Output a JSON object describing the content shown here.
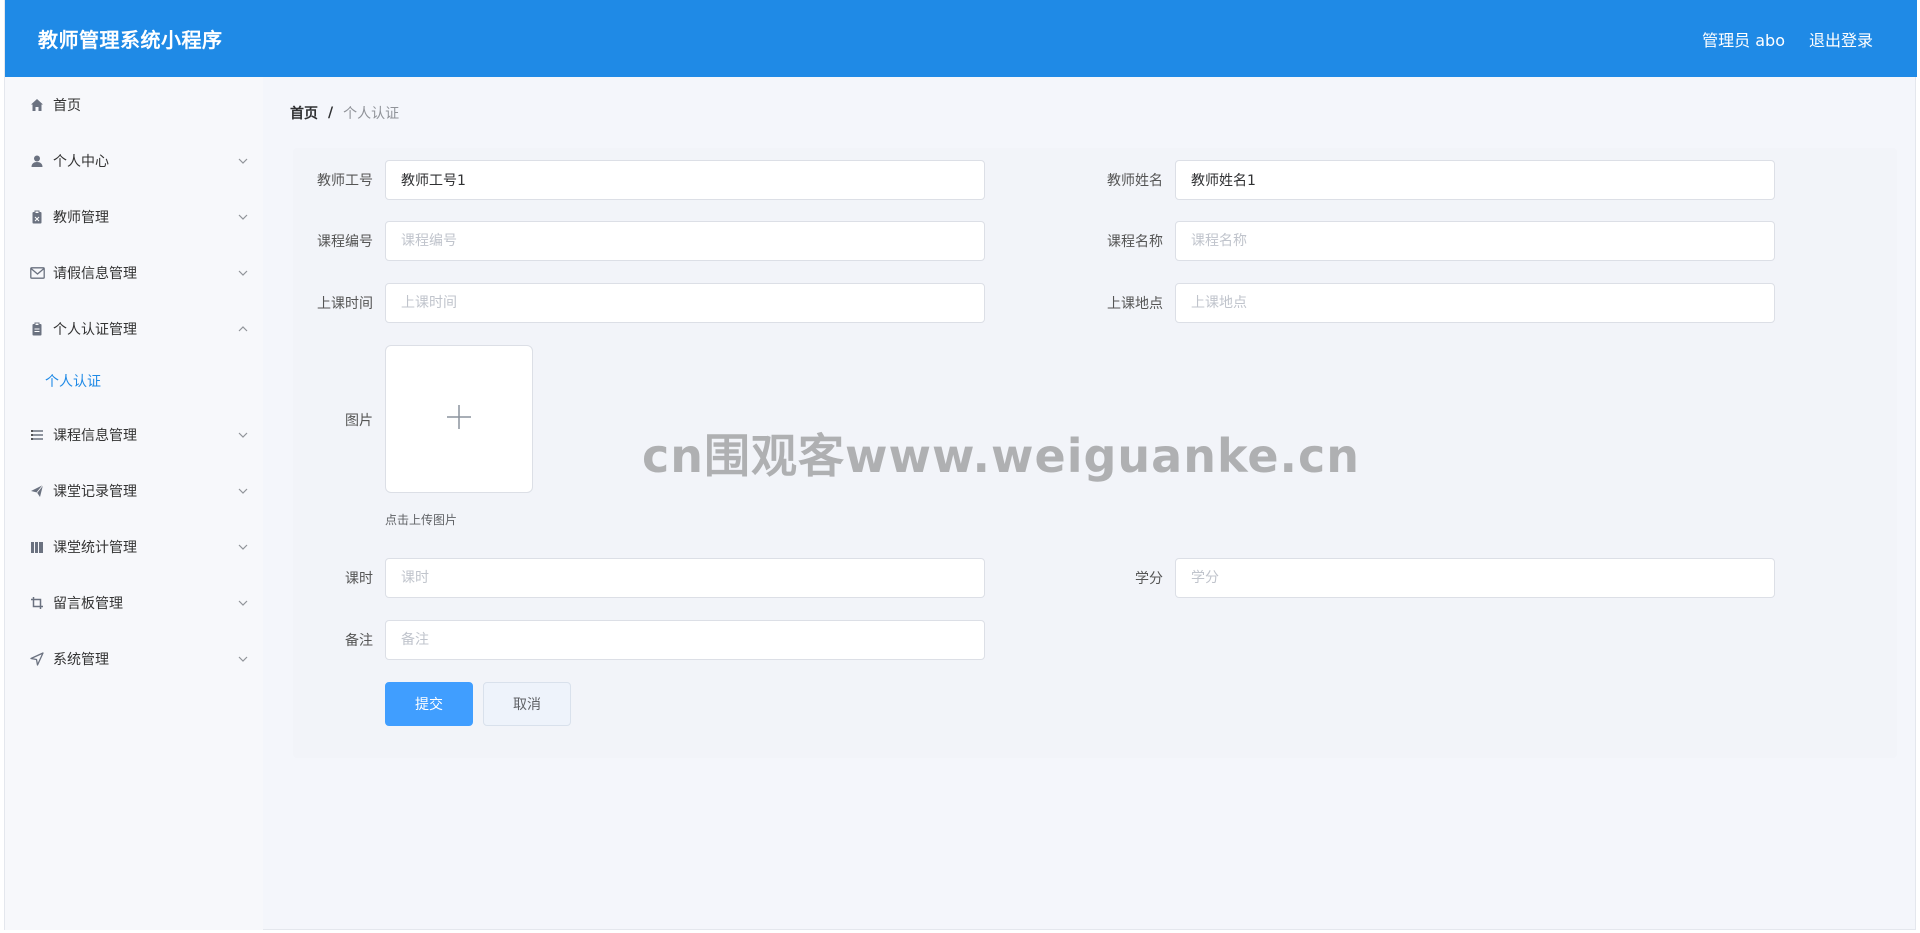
{
  "header": {
    "title": "教师管理系统小程序",
    "user_label": "管理员 abo",
    "logout_label": "退出登录"
  },
  "sidebar": {
    "items": [
      {
        "label": "首页",
        "icon": "home-icon"
      },
      {
        "label": "个人中心",
        "icon": "user-icon"
      },
      {
        "label": "教师管理",
        "icon": "clipboard-icon"
      },
      {
        "label": "请假信息管理",
        "icon": "mail-icon"
      },
      {
        "label": "个人认证管理",
        "icon": "document-icon"
      },
      {
        "label": "课程信息管理",
        "icon": "list-icon"
      },
      {
        "label": "课堂记录管理",
        "icon": "send-icon"
      },
      {
        "label": "课堂统计管理",
        "icon": "book-icon"
      },
      {
        "label": "留言板管理",
        "icon": "crop-icon"
      },
      {
        "label": "系统管理",
        "icon": "navigation-icon"
      }
    ],
    "submenu": {
      "label": "个人认证"
    }
  },
  "breadcrumb": {
    "home": "首页",
    "separator": "/",
    "current": "个人认证"
  },
  "form": {
    "teacher_id": {
      "label": "教师工号",
      "value": "教师工号1",
      "placeholder": "教师工号"
    },
    "teacher_name": {
      "label": "教师姓名",
      "value": "教师姓名1",
      "placeholder": "教师姓名"
    },
    "course_no": {
      "label": "课程编号",
      "value": "",
      "placeholder": "课程编号"
    },
    "course_name": {
      "label": "课程名称",
      "value": "",
      "placeholder": "课程名称"
    },
    "class_time": {
      "label": "上课时间",
      "value": "",
      "placeholder": "上课时间"
    },
    "class_place": {
      "label": "上课地点",
      "value": "",
      "placeholder": "上课地点"
    },
    "image": {
      "label": "图片",
      "hint": "点击上传图片"
    },
    "hours": {
      "label": "课时",
      "value": "",
      "placeholder": "课时"
    },
    "credits": {
      "label": "学分",
      "value": "",
      "placeholder": "学分"
    },
    "remark": {
      "label": "备注",
      "value": "",
      "placeholder": "备注"
    },
    "submit_label": "提交",
    "cancel_label": "取消"
  },
  "watermark": "cn围观客www.weiguanke.cn",
  "colors": {
    "header_bg": "#1f8ae6",
    "primary": "#409eff",
    "active_menu": "#1f8ae6"
  }
}
